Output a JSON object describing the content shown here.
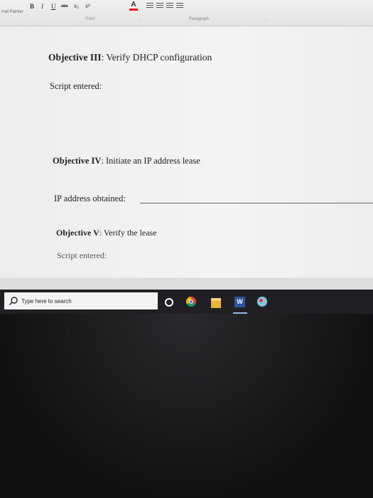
{
  "ribbon": {
    "painter_label": "mat Painter",
    "bold": "B",
    "italic": "I",
    "underline": "U",
    "strike": "abc",
    "subscript": "x₂",
    "superscript": "x²",
    "font_color_label": "A",
    "font_group": "Font",
    "paragraph_group": "Paragraph"
  },
  "document": {
    "obj3_prefix": "Objective III",
    "obj3_text": ": Verify DHCP configuration",
    "script1": "Script entered:",
    "obj4_prefix": "Objective IV",
    "obj4_text": ": Initiate an IP address lease",
    "ip_label": "IP address obtained:",
    "obj5_prefix": "Objective V",
    "obj5_text": ": Verify the lease",
    "script2": "Script entered:"
  },
  "taskbar": {
    "search_placeholder": "Type here to search",
    "word_label": "W"
  },
  "colors": {
    "font_color": "#e01a1a",
    "taskbar": "#202024",
    "word": "#2b579a"
  }
}
